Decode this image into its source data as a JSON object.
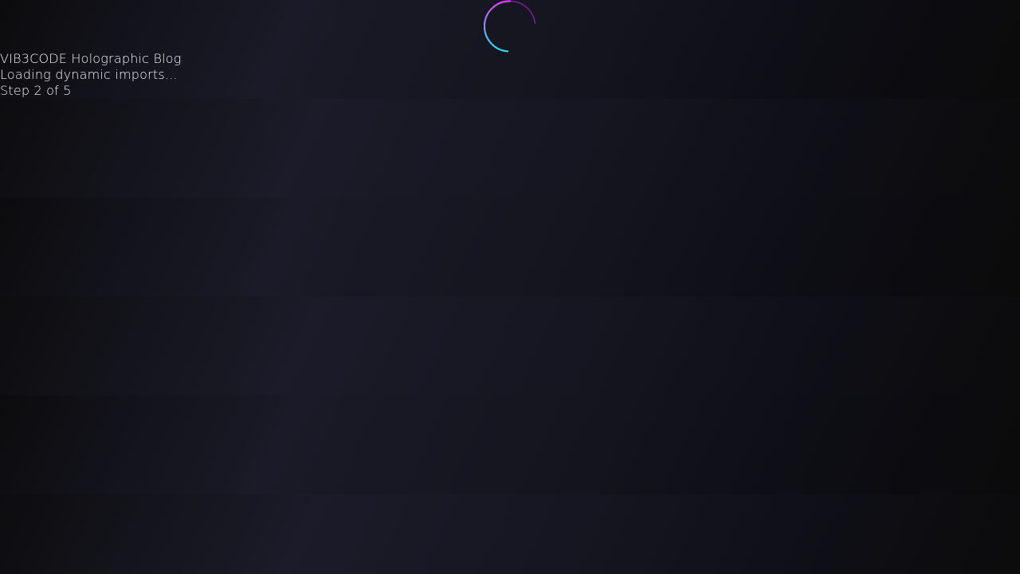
{
  "loader": {
    "title": "VIB3CODE Holographic Blog",
    "status": "Loading dynamic imports...",
    "step": "Step 2 of 5"
  },
  "spinner": {
    "icon": "loading-spinner-icon",
    "colors": {
      "primary": "#e03cff",
      "secondary": "#22e6f0"
    }
  },
  "theme": {
    "background": "#13131c",
    "text": "#f2f2f7"
  }
}
